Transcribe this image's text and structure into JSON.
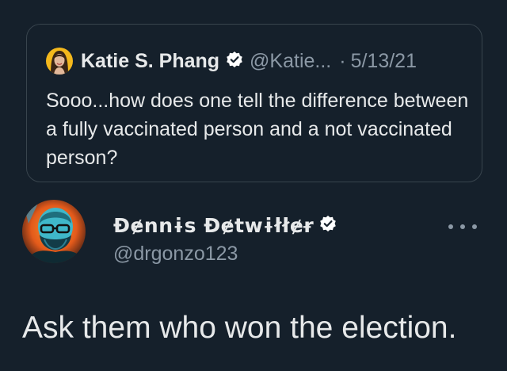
{
  "quoted_tweet": {
    "author_name": "Katie S. Phang",
    "handle": "@Katie...",
    "separator": "·",
    "date": "5/13/21",
    "text": "Sooo...how does one tell the difference between a fully vaccinated person and a not vaccinated person?",
    "verified": true,
    "avatar_icon": "woman-portrait-icon"
  },
  "tweet": {
    "author_name": "Đɇnnɨs Đɇtwɨłłɇɍ",
    "handle": "@drgonzo123",
    "text": "Ask them who won the election.",
    "verified": true,
    "avatar_icon": "bearded-man-glasses-portrait-icon",
    "more_icon": "more-options-icon"
  },
  "colors": {
    "background": "#15202b",
    "border": "#38444d",
    "primary_text": "#e7e9ea",
    "secondary_text": "#8b98a5",
    "verified_badge": "#ffffff"
  }
}
